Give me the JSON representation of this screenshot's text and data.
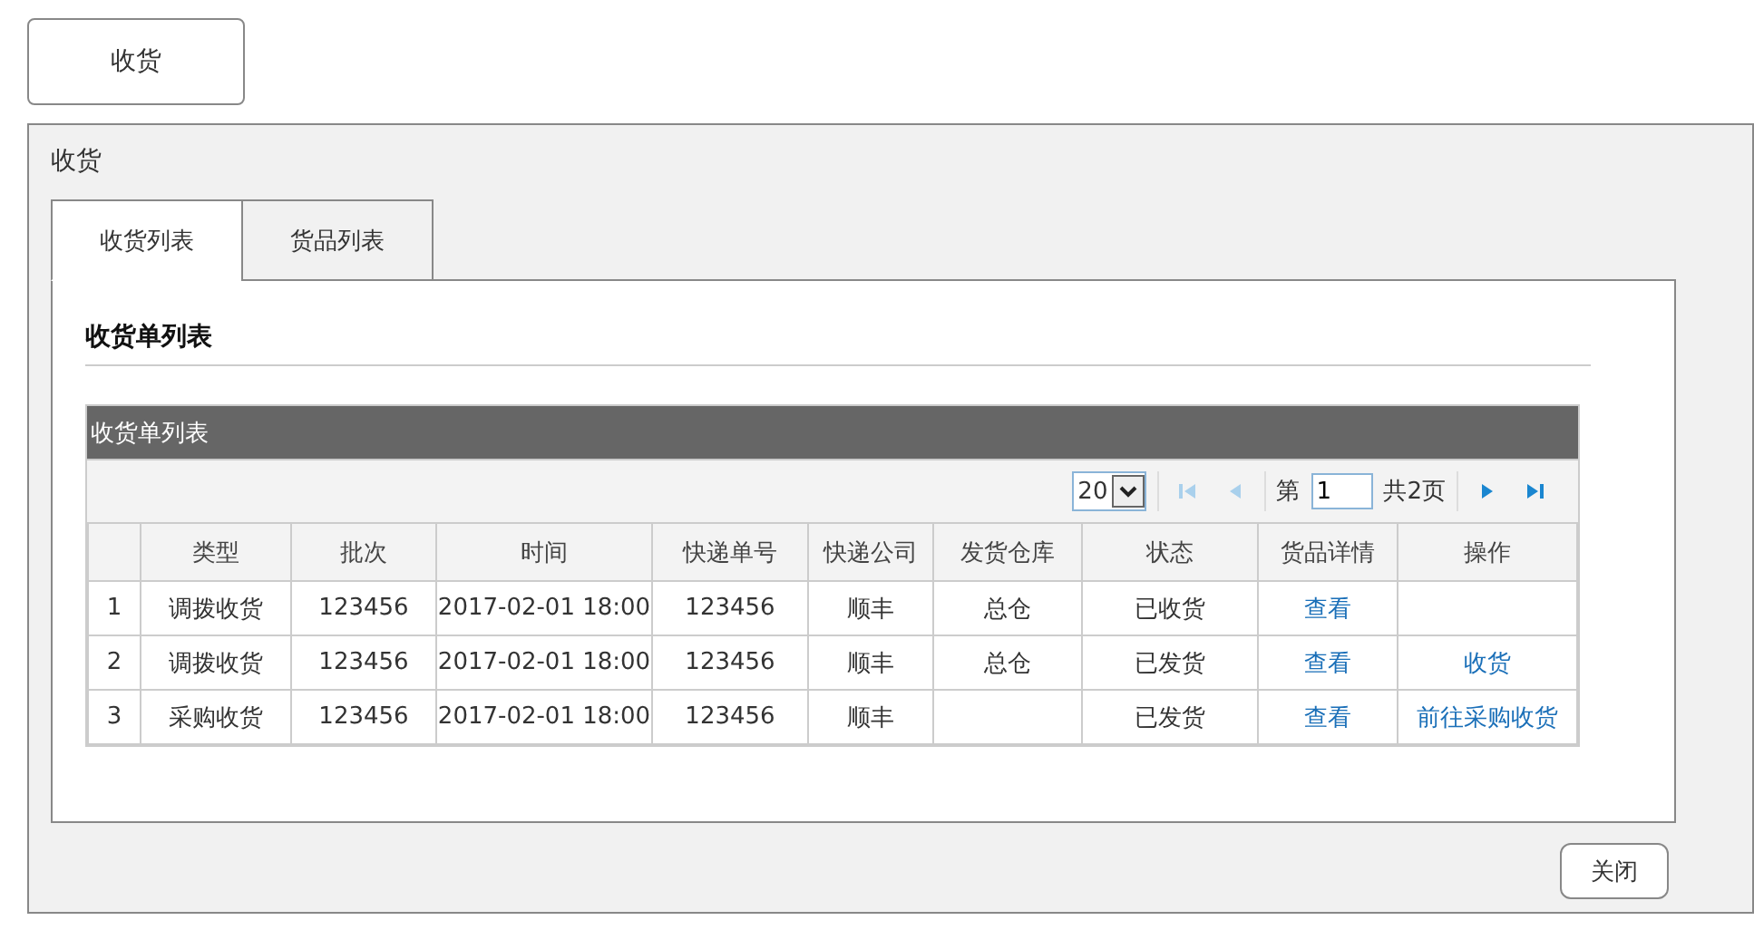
{
  "launch_button": {
    "label": "收货"
  },
  "dialog": {
    "title": "收货",
    "tabs": [
      {
        "label": "收货列表",
        "selected": true
      },
      {
        "label": "货品列表",
        "selected": false
      }
    ],
    "section_title": "收货单列表",
    "grid": {
      "title": "收货单列表",
      "pager": {
        "page_size": "20",
        "page_prefix": "第",
        "page": "1",
        "page_total": "共2页",
        "buttons": [
          {
            "kind": "first",
            "disabled": true
          },
          {
            "kind": "prev",
            "disabled": true
          },
          {
            "kind": "next",
            "disabled": false
          },
          {
            "kind": "last",
            "disabled": false
          }
        ]
      },
      "columns": [
        "类型",
        "批次",
        "时间",
        "快递单号",
        "快递公司",
        "发货仓库",
        "状态",
        "货品详情",
        "操作"
      ],
      "rows": [
        {
          "number": "1",
          "type": "调拨收货",
          "batch": "123456",
          "time": "2017-02-01 18:00",
          "tracking_no": "123456",
          "courier": "顺丰",
          "warehouse": "总仓",
          "status": "已收货",
          "detail_link": "查看"
        },
        {
          "number": "2",
          "type": "调拨收货",
          "batch": "123456",
          "time": "2017-02-01 18:00",
          "tracking_no": "123456",
          "courier": "顺丰",
          "warehouse": "总仓",
          "status": "已发货",
          "detail_link": "查看",
          "action_link": "收货"
        },
        {
          "number": "3",
          "type": "采购收货",
          "batch": "123456",
          "time": "2017-02-01 18:00",
          "tracking_no": "123456",
          "courier": "顺丰",
          "status": "已发货",
          "detail_link": "查看",
          "action_link": "前往采购收货"
        }
      ]
    },
    "close_button": "关闭"
  }
}
